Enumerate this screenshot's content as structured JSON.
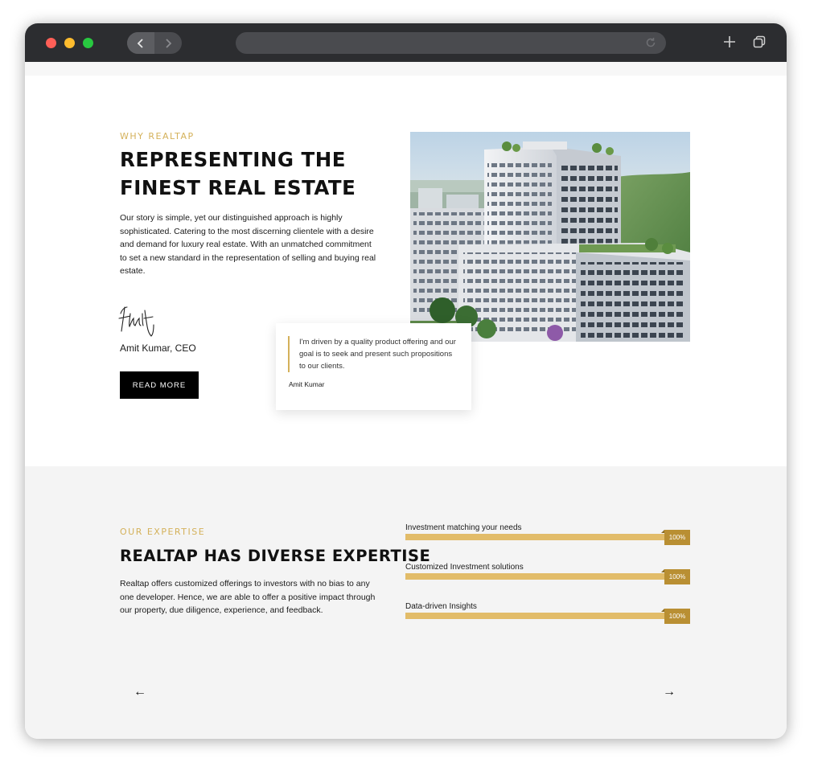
{
  "browser": {
    "back_icon": "chevron-left-icon",
    "forward_icon": "chevron-right-icon",
    "reload_icon": "reload-icon",
    "new_tab_icon": "plus-icon",
    "tabs_icon": "tabs-overview-icon"
  },
  "colors": {
    "accent_gold": "#d4b15a",
    "bar_gold": "#e2bc69",
    "badge_gold": "#b98f33",
    "text_dark": "#111111"
  },
  "why": {
    "eyebrow": "WHY REALTAP",
    "heading_line1": "REPRESENTING THE",
    "heading_line2": "FINEST REAL ESTATE",
    "body": "Our story is simple, yet our distinguished approach is highly sophisticated. Catering to the most discerning clientele with a desire and demand for luxury real estate. With an unmatched commitment to set a new standard in the representation of selling and buying real estate.",
    "signature_text": "Amit",
    "ceo_name": "Amit Kumar, CEO",
    "read_more": "READ MORE"
  },
  "quote": {
    "text": "I'm driven by a quality product offering and our goal is to seek and present such propositions to our clients.",
    "author": "Amit Kumar"
  },
  "expertise": {
    "eyebrow": "OUR EXPERTISE",
    "heading": "REALTAP HAS DIVERSE EXPERTISE",
    "body": "Realtap offers customized offerings to investors with no bias to any one developer. Hence, we are able to offer a positive impact through our property, due diligence, experience, and feedback.",
    "skills": [
      {
        "label": "Investment matching your needs",
        "percent": 100,
        "percent_text": "100%"
      },
      {
        "label": "Customized Investment solutions",
        "percent": 100,
        "percent_text": "100%"
      },
      {
        "label": "Data-driven Insights",
        "percent": 100,
        "percent_text": "100%"
      }
    ],
    "prev_arrow": "←",
    "next_arrow": "→"
  }
}
